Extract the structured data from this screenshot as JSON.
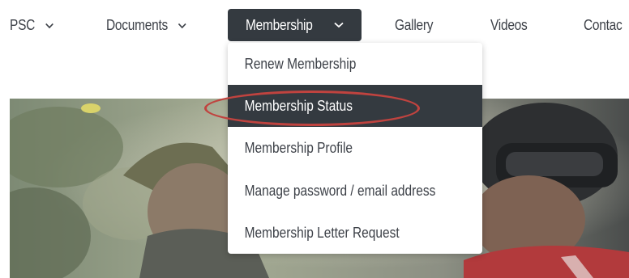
{
  "nav": {
    "items": [
      {
        "label": "PSC",
        "has_dropdown": true
      },
      {
        "label": "Documents",
        "has_dropdown": true
      },
      {
        "label": "Membership",
        "has_dropdown": true,
        "active": true
      },
      {
        "label": "Gallery",
        "has_dropdown": false
      },
      {
        "label": "Videos",
        "has_dropdown": false
      },
      {
        "label": "Contac",
        "has_dropdown": false
      }
    ]
  },
  "membership_menu": {
    "items": [
      {
        "label": "Renew Membership"
      },
      {
        "label": "Membership Status",
        "selected": true
      },
      {
        "label": "Membership Profile"
      },
      {
        "label": "Manage password / email address"
      },
      {
        "label": "Membership Letter Request"
      }
    ]
  },
  "annotation": {
    "color": "#c0433f",
    "target": "Membership Status"
  },
  "colors": {
    "nav_active_bg": "#343a40",
    "text": "#3d4148",
    "highlight": "#c0433f"
  },
  "icons": {
    "dropdown": "chevron-down-icon"
  }
}
